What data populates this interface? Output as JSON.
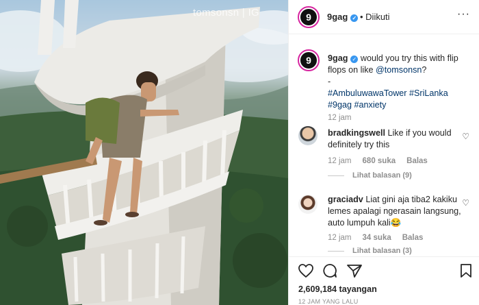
{
  "media": {
    "watermark": "tomsonsn",
    "watermark_suffix": "IG"
  },
  "header": {
    "username": "9gag",
    "follow_status": "• Diikuti",
    "avatar_letter": "9"
  },
  "caption": {
    "username": "9gag",
    "text_1": "would you try this with flip flops on like",
    "mention": "@tomsonsn",
    "text_2": "?",
    "dash": "-",
    "hashtags": "#AmbuluwawaTower #SriLanka #9gag #anxiety",
    "time": "12 jam"
  },
  "comments": [
    {
      "username": "bradkingswell",
      "text": "Like if you would definitely try this",
      "time": "12 jam",
      "likes": "680 suka",
      "reply": "Balas",
      "view_replies": "Lihat balasan (9)"
    },
    {
      "username": "graciadv",
      "text": "Liat gini aja tiba2 kakiku lemes apalagi ngerasain langsung, auto lumpuh kali😂",
      "time": "12 jam",
      "likes": "34 suka",
      "reply": "Balas",
      "view_replies": "Lihat balasan (3)"
    }
  ],
  "footer": {
    "views": "2,609,184 tayangan",
    "posted_ago": "12 JAM YANG LALU"
  }
}
